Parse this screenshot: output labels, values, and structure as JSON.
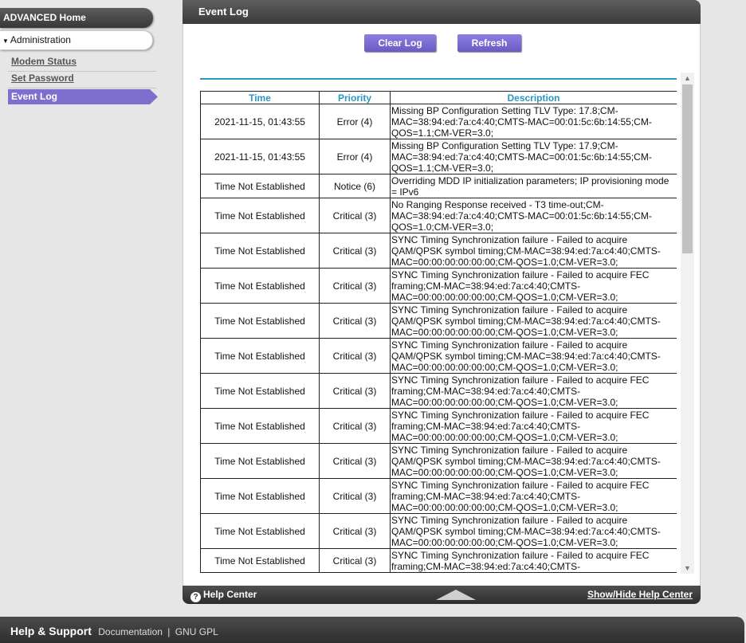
{
  "sidebar": {
    "advanced_home": "ADVANCED Home",
    "administration": "Administration",
    "items": [
      {
        "label": "Modem Status"
      },
      {
        "label": "Set Password"
      },
      {
        "label": "Event Log"
      }
    ]
  },
  "panel": {
    "title": "Event Log",
    "clear_log": "Clear Log",
    "refresh": "Refresh",
    "headers": {
      "time": "Time",
      "priority": "Priority",
      "description": "Description"
    }
  },
  "events": [
    {
      "time": "2021-11-15, 01:43:55",
      "priority": "Error (4)",
      "description": "Missing BP Configuration Setting TLV Type: 17.8;CM-MAC=38:94:ed:7a:c4:40;CMTS-MAC=00:01:5c:6b:14:55;CM-QOS=1.1;CM-VER=3.0;"
    },
    {
      "time": "2021-11-15, 01:43:55",
      "priority": "Error (4)",
      "description": "Missing BP Configuration Setting TLV Type: 17.9;CM-MAC=38:94:ed:7a:c4:40;CMTS-MAC=00:01:5c:6b:14:55;CM-QOS=1.1;CM-VER=3.0;"
    },
    {
      "time": "Time Not Established",
      "priority": "Notice (6)",
      "description": "Overriding MDD IP initialization parameters; IP provisioning mode = IPv6"
    },
    {
      "time": "Time Not Established",
      "priority": "Critical (3)",
      "description": "No Ranging Response received - T3 time-out;CM-MAC=38:94:ed:7a:c4:40;CMTS-MAC=00:01:5c:6b:14:55;CM-QOS=1.0;CM-VER=3.0;"
    },
    {
      "time": "Time Not Established",
      "priority": "Critical (3)",
      "description": "SYNC Timing Synchronization failure - Failed to acquire QAM/QPSK symbol timing;CM-MAC=38:94:ed:7a:c4:40;CMTS-MAC=00:00:00:00:00:00;CM-QOS=1.0;CM-VER=3.0;"
    },
    {
      "time": "Time Not Established",
      "priority": "Critical (3)",
      "description": "SYNC Timing Synchronization failure - Failed to acquire FEC framing;CM-MAC=38:94:ed:7a:c4:40;CMTS-MAC=00:00:00:00:00:00;CM-QOS=1.0;CM-VER=3.0;"
    },
    {
      "time": "Time Not Established",
      "priority": "Critical (3)",
      "description": "SYNC Timing Synchronization failure - Failed to acquire QAM/QPSK symbol timing;CM-MAC=38:94:ed:7a:c4:40;CMTS-MAC=00:00:00:00:00:00;CM-QOS=1.0;CM-VER=3.0;"
    },
    {
      "time": "Time Not Established",
      "priority": "Critical (3)",
      "description": "SYNC Timing Synchronization failure - Failed to acquire QAM/QPSK symbol timing;CM-MAC=38:94:ed:7a:c4:40;CMTS-MAC=00:00:00:00:00:00;CM-QOS=1.0;CM-VER=3.0;"
    },
    {
      "time": "Time Not Established",
      "priority": "Critical (3)",
      "description": "SYNC Timing Synchronization failure - Failed to acquire FEC framing;CM-MAC=38:94:ed:7a:c4:40;CMTS-MAC=00:00:00:00:00:00;CM-QOS=1.0;CM-VER=3.0;"
    },
    {
      "time": "Time Not Established",
      "priority": "Critical (3)",
      "description": "SYNC Timing Synchronization failure - Failed to acquire FEC framing;CM-MAC=38:94:ed:7a:c4:40;CMTS-MAC=00:00:00:00:00:00;CM-QOS=1.0;CM-VER=3.0;"
    },
    {
      "time": "Time Not Established",
      "priority": "Critical (3)",
      "description": "SYNC Timing Synchronization failure - Failed to acquire QAM/QPSK symbol timing;CM-MAC=38:94:ed:7a:c4:40;CMTS-MAC=00:00:00:00:00:00;CM-QOS=1.0;CM-VER=3.0;"
    },
    {
      "time": "Time Not Established",
      "priority": "Critical (3)",
      "description": "SYNC Timing Synchronization failure - Failed to acquire FEC framing;CM-MAC=38:94:ed:7a:c4:40;CMTS-MAC=00:00:00:00:00:00;CM-QOS=1.0;CM-VER=3.0;"
    },
    {
      "time": "Time Not Established",
      "priority": "Critical (3)",
      "description": "SYNC Timing Synchronization failure - Failed to acquire QAM/QPSK symbol timing;CM-MAC=38:94:ed:7a:c4:40;CMTS-MAC=00:00:00:00:00:00;CM-QOS=1.0;CM-VER=3.0;"
    },
    {
      "time": "Time Not Established",
      "priority": "Critical (3)",
      "description": "SYNC Timing Synchronization failure - Failed to acquire FEC framing;CM-MAC=38:94:ed:7a:c4:40;CMTS-"
    }
  ],
  "bottom_bar": {
    "help_center": "Help Center",
    "show_hide": "Show/Hide Help Center"
  },
  "footer": {
    "title": "Help & Support",
    "documentation": "Documentation",
    "separator": "|",
    "gnu_gpl": "GNU GPL"
  },
  "colors": {
    "accent": "#7e6fcf",
    "header_text": "#2a97c3",
    "divider": "#2c9bb8"
  }
}
